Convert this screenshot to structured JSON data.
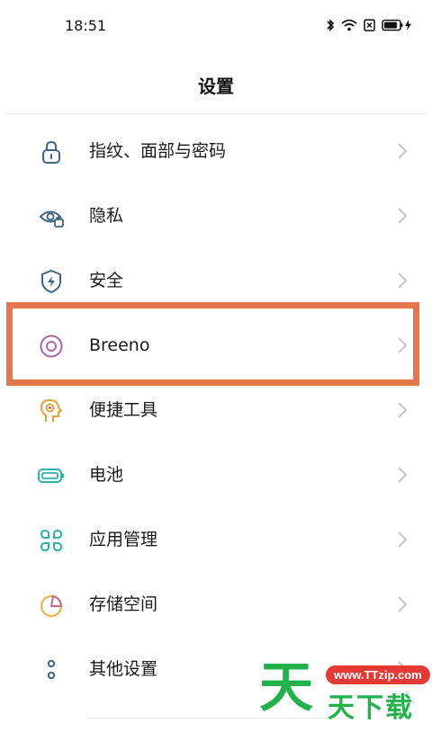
{
  "status_bar": {
    "time": "18:51",
    "icons": [
      "bluetooth-icon",
      "wifi-icon",
      "sim-blocked-icon",
      "battery-charging-icon"
    ]
  },
  "header": {
    "title": "设置"
  },
  "settings": {
    "items": [
      {
        "label": "指纹、面部与密码",
        "icon": "lock-icon",
        "color": "#3f6680"
      },
      {
        "label": "隐私",
        "icon": "privacy-eye-icon",
        "color": "#3f6680"
      },
      {
        "label": "安全",
        "icon": "security-shield-icon",
        "color": "#3f6680"
      },
      {
        "label": "Breeno",
        "icon": "breeno-icon",
        "color": "#a86aa6"
      },
      {
        "label": "便捷工具",
        "icon": "convenience-tools-icon",
        "color": "#e2a23b"
      },
      {
        "label": "电池",
        "icon": "battery-icon",
        "color": "#2fb2a6"
      },
      {
        "label": "应用管理",
        "icon": "app-management-icon",
        "color": "#2fb2a6"
      },
      {
        "label": "存储空间",
        "icon": "storage-icon",
        "color": "#e8b13a"
      },
      {
        "label": "其他设置",
        "icon": "other-settings-icon",
        "color": "#3f6680"
      }
    ],
    "highlighted_item": "Breeno",
    "highlight_color": "#e4774e"
  },
  "watermark": {
    "big_char": "天",
    "url": "www.TTzip.com",
    "sub_text": "天下载",
    "color": "#22b24c",
    "url_bg": "#e53935"
  }
}
